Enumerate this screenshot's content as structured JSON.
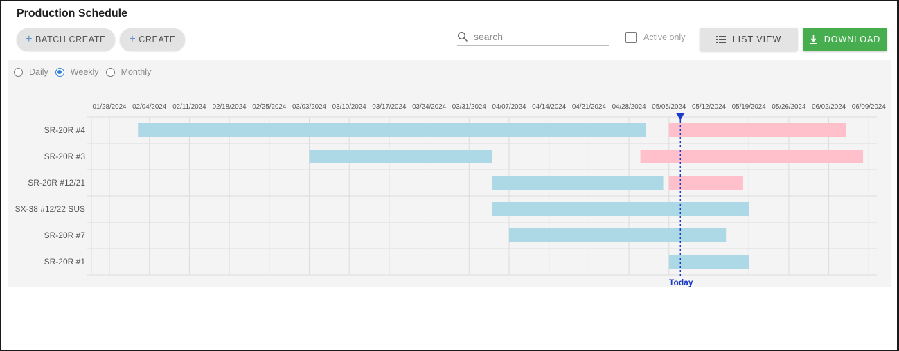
{
  "header": {
    "title": "Production Schedule"
  },
  "toolbar": {
    "batch_create_label": "BATCH CREATE",
    "create_label": "CREATE",
    "search_placeholder": "search",
    "search_value": "",
    "active_only_label": "Active only",
    "active_only_checked": false,
    "list_view_label": "LIST VIEW",
    "download_label": "DOWNLOAD",
    "download_color": "#47ae50"
  },
  "view_mode": {
    "options": [
      "Daily",
      "Weekly",
      "Monthly"
    ],
    "selected": "Weekly"
  },
  "chart_data": {
    "type": "gantt",
    "x_ticks": [
      "01/28/2024",
      "02/04/2024",
      "02/11/2024",
      "02/18/2024",
      "02/25/2024",
      "03/03/2024",
      "03/10/2024",
      "03/17/2024",
      "03/24/2024",
      "03/31/2024",
      "04/07/2024",
      "04/14/2024",
      "04/21/2024",
      "04/28/2024",
      "05/05/2024",
      "05/12/2024",
      "05/19/2024",
      "05/26/2024",
      "06/02/2024",
      "06/09/2024"
    ],
    "today": {
      "label": "Today",
      "date": "2024-05-07"
    },
    "colors": {
      "planned": "#add8e6",
      "overdue": "#ffc0cb",
      "today": "#1a3cc8"
    },
    "rows": [
      {
        "name": "SR-20R #4",
        "bars": [
          {
            "start": "2024-02-02",
            "end": "2024-05-01",
            "status": "planned"
          },
          {
            "start": "2024-05-05",
            "end": "2024-06-05",
            "status": "overdue"
          }
        ]
      },
      {
        "name": "SR-20R #3",
        "bars": [
          {
            "start": "2024-03-03",
            "end": "2024-04-04",
            "status": "planned"
          },
          {
            "start": "2024-04-30",
            "end": "2024-06-08",
            "status": "overdue"
          }
        ]
      },
      {
        "name": "SR-20R #12/21",
        "bars": [
          {
            "start": "2024-04-04",
            "end": "2024-05-04",
            "status": "planned"
          },
          {
            "start": "2024-05-05",
            "end": "2024-05-18",
            "status": "overdue"
          }
        ]
      },
      {
        "name": "SX-38 #12/22 SUS",
        "bars": [
          {
            "start": "2024-04-04",
            "end": "2024-05-19",
            "status": "planned"
          }
        ]
      },
      {
        "name": "SR-20R #7",
        "bars": [
          {
            "start": "2024-04-07",
            "end": "2024-05-15",
            "status": "planned"
          }
        ]
      },
      {
        "name": "SR-20R #1",
        "bars": [
          {
            "start": "2024-05-05",
            "end": "2024-05-19",
            "status": "planned"
          }
        ]
      }
    ]
  }
}
